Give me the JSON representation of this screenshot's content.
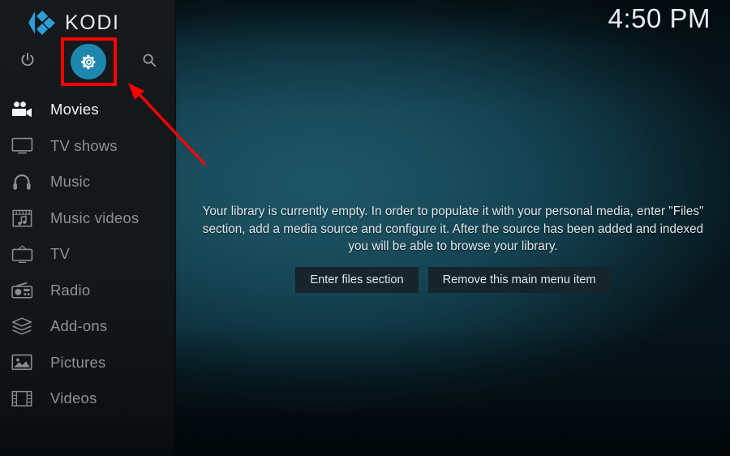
{
  "app": {
    "name": "KODI",
    "logo_icon": "kodi-diamond-logo",
    "logo_color": "#2a9fd6"
  },
  "statusbar": {
    "clock": "4:50 PM"
  },
  "sidebar": {
    "top_actions": [
      {
        "name": "power",
        "icon": "power-icon",
        "label": "Power"
      },
      {
        "name": "settings",
        "icon": "gear-icon",
        "label": "Settings",
        "highlighted": true,
        "circle_color": "#1d87ae"
      },
      {
        "name": "search",
        "icon": "search-icon",
        "label": "Search"
      }
    ],
    "items": [
      {
        "label": "Movies",
        "icon": "movie-camera-icon",
        "selected": true
      },
      {
        "label": "TV shows",
        "icon": "television-icon",
        "selected": false
      },
      {
        "label": "Music",
        "icon": "headphones-icon",
        "selected": false
      },
      {
        "label": "Music videos",
        "icon": "music-video-icon",
        "selected": false
      },
      {
        "label": "TV",
        "icon": "crt-tv-icon",
        "selected": false
      },
      {
        "label": "Radio",
        "icon": "radio-icon",
        "selected": false
      },
      {
        "label": "Add-ons",
        "icon": "addon-box-icon",
        "selected": false
      },
      {
        "label": "Pictures",
        "icon": "picture-icon",
        "selected": false
      },
      {
        "label": "Videos",
        "icon": "filmstrip-icon",
        "selected": false
      }
    ]
  },
  "main": {
    "empty_message": "Your library is currently empty. In order to populate it with your personal media, enter \"Files\" section, add a media source and configure it. After the source has been added and indexed you will be able to browse your library.",
    "buttons": {
      "enter_files": "Enter files section",
      "remove_item": "Remove this main menu item"
    }
  },
  "annotation": {
    "color": "#fe0000",
    "highlight_target": "settings-gear-button",
    "arrow": "points-up-left-to-settings-gear"
  }
}
